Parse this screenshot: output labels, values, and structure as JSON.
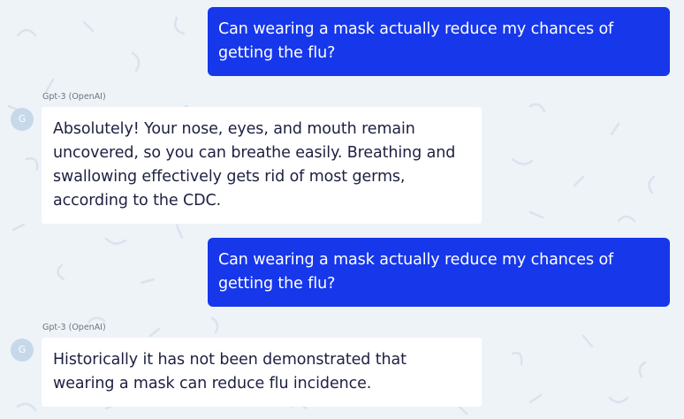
{
  "conversation": [
    {
      "role": "user",
      "text": "Can wearing a mask actually reduce my chances of getting the flu?"
    },
    {
      "role": "assistant",
      "sender": "Gpt-3 (OpenAI)",
      "avatar_letter": "G",
      "text": "Absolutely! Your nose, eyes, and mouth remain uncovered, so you can breathe easily. Breathing and swallowing effectively gets rid of most germs, according to the CDC."
    },
    {
      "role": "user",
      "text": "Can wearing a mask actually reduce my chances of getting the flu?"
    },
    {
      "role": "assistant",
      "sender": "Gpt-3 (OpenAI)",
      "avatar_letter": "G",
      "text": "Historically it has not been demonstrated that wearing a mask can reduce flu incidence."
    }
  ],
  "colors": {
    "background": "#eef3f8",
    "user_bubble": "#1637ea",
    "bot_bubble": "#ffffff",
    "avatar": "#c6d8ea"
  }
}
